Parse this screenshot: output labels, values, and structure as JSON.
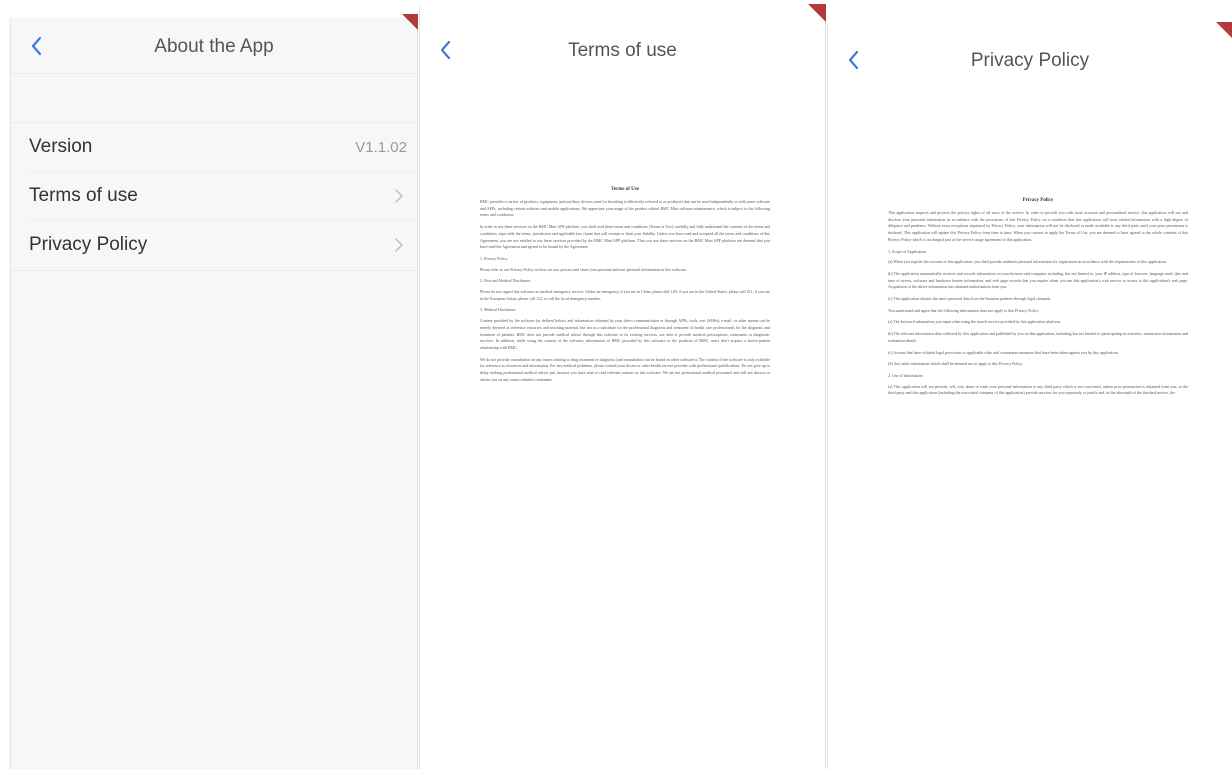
{
  "about": {
    "title": "About the App",
    "rows": [
      {
        "label": "Version",
        "value": "V1.1.02"
      },
      {
        "label": "Terms of use"
      },
      {
        "label": "Privacy Policy"
      }
    ]
  },
  "terms": {
    "title": "Terms of use",
    "doc_title": "Terms of Use",
    "p1": "BMC provides a variety of products, equipment, and auxiliary devices used for breathing (collectively referred to as products) that can be used independently or with some software and APPs, including certain websites and mobile applications. We appreciate your usage of the product related BMC Mini software maintenance, which is subject to the following terms and conditions.",
    "p2": "In order to use these services on the BMC Mini APP platform, you shall read these terms and conditions (Terms of Use) carefully and fully understand the contents of the terms and conditions, especially the terms, jurisdiction and applicable law clause that will exempt or limit your liability. Unless you have read and accepted all the terms and conditions of this Agreement, you are not entitled to use these services provided by the BMC Mini APP platform. That you use these services on the BMC Mini APP platform are deemed that you have read the Agreement and agreed to be bound by the Agreement.",
    "h1": "1. Privacy Policy",
    "p3": "Please refer to our Privacy Policy on how we use, process and share your personal and non-personal information in this software.",
    "h2": "2. First-aid Medical Disclaimer",
    "p4": "Please do not regard this software as medical emergency service. Under an emergency, if you are in China, please dial 120; if you are in the United States, please call 911; if you are in the European Union, please call 112, or call the local emergency number.",
    "h3": "3. Medical Disclaimer",
    "p5": "Content provided by the software (as defined below) and information obtained by your direct communication or through APPs, tools, text (SMSs), e-mail, or other means can be merely deemed as reference resources and teaching material, but not as a substitute for the professional diagnosis and treatment of health care professionals for the diagnosis and treatment of patients. BMC does not provide medical advice through this software or its existing services, nor does it provide medical prescriptions, treatments or diagnostic services. In addition, while using the content of the software, information of BMC provided by this software or the products of BMC, users don't acquire a doctor-patient relationship with BMC.",
    "p6": "We do not provide consultation on any issues relating to drug treatment or diagnosis (and consultation can be found on other softwares). The content of the software is only available for reference as resources and information. For any medical problems, please consult your doctor or other health service provider with professional qualifications. Do not give up or delay seeking professional medical advice just because you have read or read relevant content on this software. We are not professional medical personnel and will not discuss or advise you on any issues related to treatment."
  },
  "privacy": {
    "title": "Privacy Policy",
    "doc_title": "Privacy Policy",
    "p1": "This application respects and protects the privacy rights of all users of the service. In order to provide you with more accurate and personalized service, this application will use and disclose your personal information in accordance with the provisions of this Privacy Policy on a condition that this application will treat related information with a high degree of diligence and prudence. Without extra exceptions stipulated by Privacy Policy, your information will not be disclosed or made available to any third party until your prior permission is declared. This application will update this Privacy Policy from time to time. When you consent to apply the Terms of Use, you are deemed to have agreed to the whole contents of this Privacy Policy which is an integral part of the service usage agreement of this application.",
    "h1": "1. Scope of Application",
    "p2": "(a) When you register the account of this application, you shall provide authentic personal information for registration in accordance with the requirements of this application.",
    "p3": "(b) The application automatically receives and records information on your browser and computer, including, but not limited to, your IP address, type of browser, language used, date and time of access, software and hardware feature information, and web page records that you require when you use this application's web service or access to this application's web page. Acquisition of the above information has obtained authorization from you.",
    "p4": "(c) This application obtains the user's personal data from the business partners through legal channels.",
    "p5": "You understand and agree that the following information does not apply to this Privacy Policy.",
    "p6": "(a) The keyword information you input when using the search service provided by this application platform.",
    "p7": "(b) The relevant information data collected by this application and published by you on this application, including but not limited to participating in activities, transaction information and evaluation details.",
    "p8": "(c) Actions that have violated legal provisions or applicable rules and counterpart measures that have been taken against you by this application.",
    "p9": "(d) Any other information which shall be deemed not to apply to this Privacy Policy.",
    "h2": "2. Use of Information",
    "p10": "(a) This application will not provide, sell, rent, share or trade your personal information to any third party which is not concerned, unless prior permission is obtained from you, or the third party and this application (including the associated company of this application) provide services for you separately or jointly and, in the aftermath of the finished service, the"
  },
  "colors": {
    "accent": "#3d7bd6",
    "corner": "#b23a3a"
  },
  "icons": {
    "back": "chevron-left-icon",
    "row_arrow": "chevron-right-icon"
  }
}
